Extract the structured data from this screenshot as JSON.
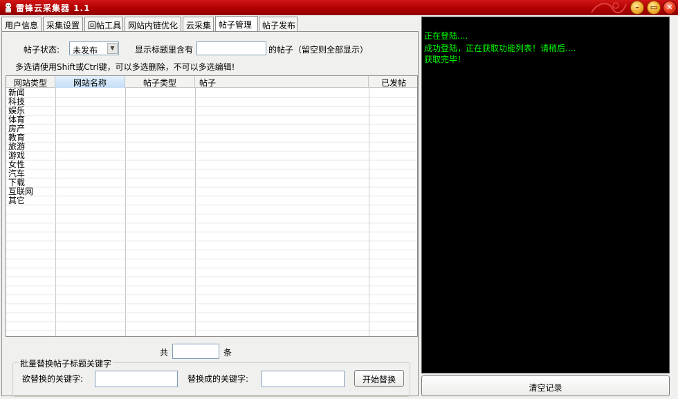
{
  "window": {
    "title": "雷锋云采集器  1.1"
  },
  "tabs": [
    {
      "label": "用户信息"
    },
    {
      "label": "采集设置"
    },
    {
      "label": "回帖工具"
    },
    {
      "label": "网站内链优化"
    },
    {
      "label": "云采集"
    },
    {
      "label": "帖子管理"
    },
    {
      "label": "帖子发布"
    }
  ],
  "filter": {
    "status_label": "帖子状态:",
    "status_value": "未发布",
    "title_label": "显示标题里含有",
    "title_value": "",
    "title_suffix": "的帖子（留空则全部显示）",
    "hint": "多选请使用Shift或Ctrl键，可以多选删除，不可以多选编辑!"
  },
  "table": {
    "columns": [
      "网站类型",
      "网站名称",
      "帖子类型",
      "帖子",
      "已发帖"
    ],
    "categories": [
      "新闻",
      "科技",
      "娱乐",
      "体育",
      "房产",
      "教育",
      "旅游",
      "游戏",
      "女性",
      "汽车",
      "下载",
      "互联网",
      "其它"
    ]
  },
  "count": {
    "prefix": "共",
    "value": "",
    "suffix": "条"
  },
  "replace": {
    "group_title": "批量替换帖子标题关键字",
    "from_label": "欲替换的关键字:",
    "from_value": "",
    "to_label": "替换成的关键字:",
    "to_value": "",
    "button": "开始替换"
  },
  "log": {
    "lines": [
      "正在登陆....",
      "成功登陆，正在获取功能列表！请稍后....",
      "获取完毕！"
    ],
    "color": "#00ff00"
  },
  "clear_button": "清空记录",
  "theme": {
    "titlebar": "#b00000",
    "log_bg": "#000000"
  }
}
